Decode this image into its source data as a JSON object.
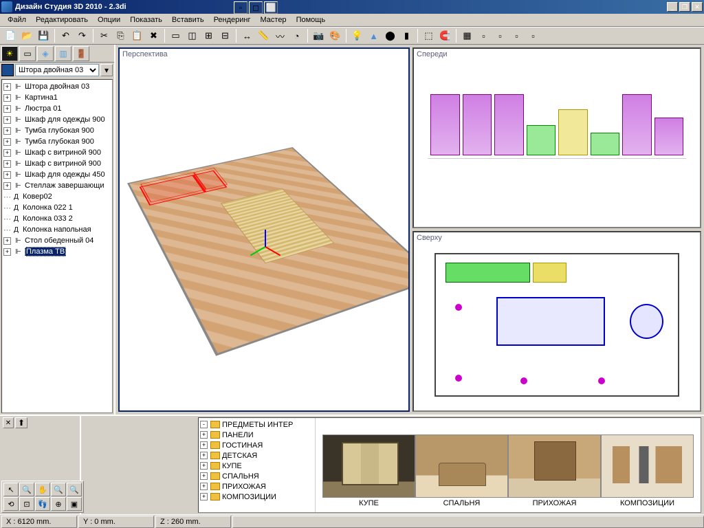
{
  "window": {
    "title": "Дизайн Студия 3D 2010 - 2.3di"
  },
  "menu": {
    "file": "Файл",
    "edit": "Редактировать",
    "options": "Опции",
    "show": "Показать",
    "insert": "Вставить",
    "rendering": "Рендеринг",
    "master": "Мастер",
    "help": "Помощь"
  },
  "left": {
    "selected_object": "Штора двойная 03",
    "tree": [
      {
        "exp": true,
        "ic": "⊞",
        "label": "Штора двойная 03"
      },
      {
        "exp": true,
        "ic": "⊞",
        "label": "Картина1"
      },
      {
        "exp": true,
        "ic": "⊞",
        "label": "Люстра 01"
      },
      {
        "exp": true,
        "ic": "⊞",
        "label": "Шкаф для одежды 900"
      },
      {
        "exp": true,
        "ic": "⊞",
        "label": "Тумба глубокая 900"
      },
      {
        "exp": true,
        "ic": "⊞",
        "label": "Тумба глубокая 900"
      },
      {
        "exp": true,
        "ic": "⊞",
        "label": "Шкаф с витриной 900"
      },
      {
        "exp": true,
        "ic": "⊞",
        "label": "Шкаф с витриной 900"
      },
      {
        "exp": true,
        "ic": "⊞",
        "label": "Шкаф для одежды 450"
      },
      {
        "exp": true,
        "ic": "⊞",
        "label": "Стеллаж завершающи"
      },
      {
        "exp": false,
        "ic": "Д",
        "label": "Ковер02"
      },
      {
        "exp": false,
        "ic": "Д",
        "label": "Колонка 022 1"
      },
      {
        "exp": false,
        "ic": "Д",
        "label": "Колонка 033 2"
      },
      {
        "exp": false,
        "ic": "Д",
        "label": "Колонка напольная"
      },
      {
        "exp": true,
        "ic": "⊞",
        "label": "Стол обеденный 04"
      },
      {
        "exp": true,
        "ic": "⊞",
        "label": "Плазма ТВ",
        "sel": true
      }
    ]
  },
  "viewports": {
    "persp": "Перспектива",
    "front": "Спереди",
    "top": "Сверху"
  },
  "library": {
    "categories": [
      "ПРЕДМЕТЫ ИНТЕР",
      "ПАНЕЛИ",
      "ГОСТИНАЯ",
      "ДЕТСКАЯ",
      "КУПЕ",
      "СПАЛЬНЯ",
      "ПРИХОЖАЯ",
      "КОМПОЗИЦИИ"
    ],
    "thumbs": [
      {
        "label": "КУПЕ",
        "cls": "th-kupe"
      },
      {
        "label": "СПАЛЬНЯ",
        "cls": "th-spal"
      },
      {
        "label": "ПРИХОЖАЯ",
        "cls": "th-prih"
      },
      {
        "label": "КОМПОЗИЦИИ",
        "cls": "th-komp"
      }
    ]
  },
  "status": {
    "x": "X : 6120 mm.",
    "y": "Y : 0 mm.",
    "z": "Z : 260 mm."
  }
}
